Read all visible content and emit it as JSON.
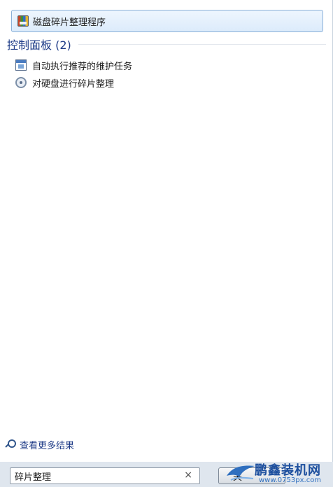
{
  "programs": {
    "top_item": {
      "label": "磁盘碎片整理程序",
      "icon": "disk-defragmenter-icon"
    }
  },
  "control_panel": {
    "title": "控制面板 (2)",
    "items": [
      {
        "label": "自动执行推荐的维护任务",
        "icon": "maintenance-task-icon"
      },
      {
        "label": "对硬盘进行碎片整理",
        "icon": "defrag-task-icon"
      }
    ]
  },
  "more_results": {
    "label": "查看更多结果",
    "icon": "search-icon"
  },
  "search": {
    "value": "碎片整理",
    "clear_glyph": "×"
  },
  "shutdown": {
    "label": "关"
  },
  "watermark": {
    "title": "鹏鑫装机网",
    "url": "www.0753px.com"
  }
}
